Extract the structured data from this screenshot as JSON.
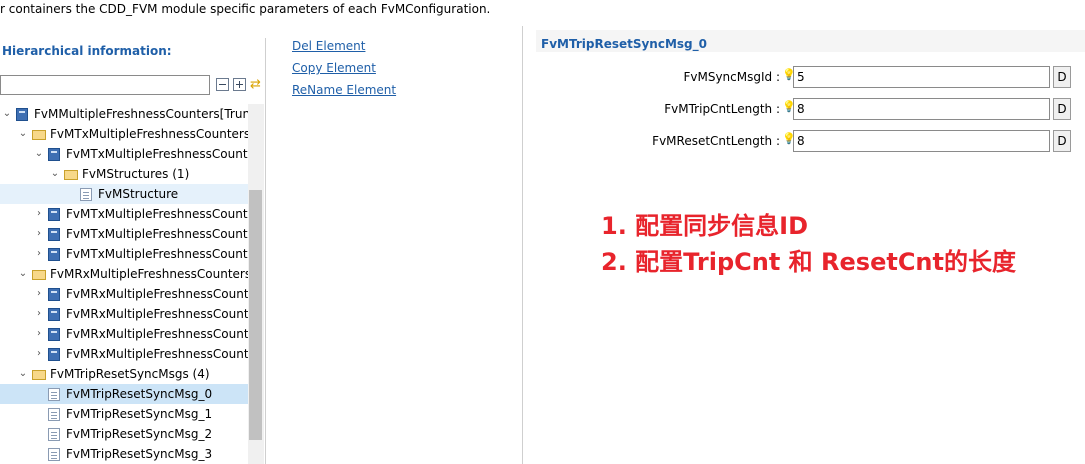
{
  "description": "r containers the CDD_FVM module specific parameters of each FvMConfiguration.",
  "hierarchy": {
    "title": "Hierarchical information:",
    "filter_value": "",
    "icons": [
      "collapse-all-icon",
      "expand-all-icon",
      "link-sync-icon"
    ]
  },
  "tree": [
    {
      "label": "FvMMultipleFreshnessCounters[Trunca",
      "expand": "open",
      "icon": "module"
    },
    {
      "label": "FvMTxMultipleFreshnessCounterss",
      "expand": "open",
      "icon": "folder"
    },
    {
      "label": "FvMTxMultipleFreshnessCounter",
      "expand": "open",
      "icon": "module"
    },
    {
      "label": "FvMStructures (1)",
      "expand": "open",
      "icon": "folder"
    },
    {
      "label": "FvMStructure",
      "expand": "none",
      "icon": "page"
    },
    {
      "label": "FvMTxMultipleFreshnessCounter",
      "expand": "closed",
      "icon": "module"
    },
    {
      "label": "FvMTxMultipleFreshnessCounter",
      "expand": "closed",
      "icon": "module"
    },
    {
      "label": "FvMTxMultipleFreshnessCounter",
      "expand": "closed",
      "icon": "module"
    },
    {
      "label": "FvMRxMultipleFreshnessCounterss",
      "expand": "open",
      "icon": "folder"
    },
    {
      "label": "FvMRxMultipleFreshnessCounter",
      "expand": "closed",
      "icon": "module"
    },
    {
      "label": "FvMRxMultipleFreshnessCounter",
      "expand": "closed",
      "icon": "module"
    },
    {
      "label": "FvMRxMultipleFreshnessCounter",
      "expand": "closed",
      "icon": "module"
    },
    {
      "label": "FvMRxMultipleFreshnessCounter",
      "expand": "closed",
      "icon": "module"
    },
    {
      "label": "FvMTripResetSyncMsgs (4)",
      "expand": "open",
      "icon": "folder"
    },
    {
      "label": "FvMTripResetSyncMsg_0",
      "expand": "none",
      "icon": "page",
      "selected": true
    },
    {
      "label": "FvMTripResetSyncMsg_1",
      "expand": "none",
      "icon": "page"
    },
    {
      "label": "FvMTripResetSyncMsg_2",
      "expand": "none",
      "icon": "page"
    },
    {
      "label": "FvMTripResetSyncMsg_3",
      "expand": "none",
      "icon": "page"
    }
  ],
  "actions": {
    "del": "Del Element",
    "copy": "Copy Element",
    "rename": "ReName Element"
  },
  "form": {
    "title": "FvMTripResetSyncMsg_0",
    "fields": [
      {
        "label": "FvMSyncMsgId :",
        "value": "5",
        "button": "D"
      },
      {
        "label": "FvMTripCntLength :",
        "value": "8",
        "button": "D"
      },
      {
        "label": "FvMResetCntLength :",
        "value": "8",
        "button": "D"
      }
    ]
  },
  "notes": {
    "line1": "1. 配置同步信息ID",
    "line2": "2. 配置TripCnt 和 ResetCnt的长度"
  },
  "colors": {
    "link": "#1f5fa8",
    "selection": "#cce4f7",
    "annotation": "#e8242c"
  }
}
